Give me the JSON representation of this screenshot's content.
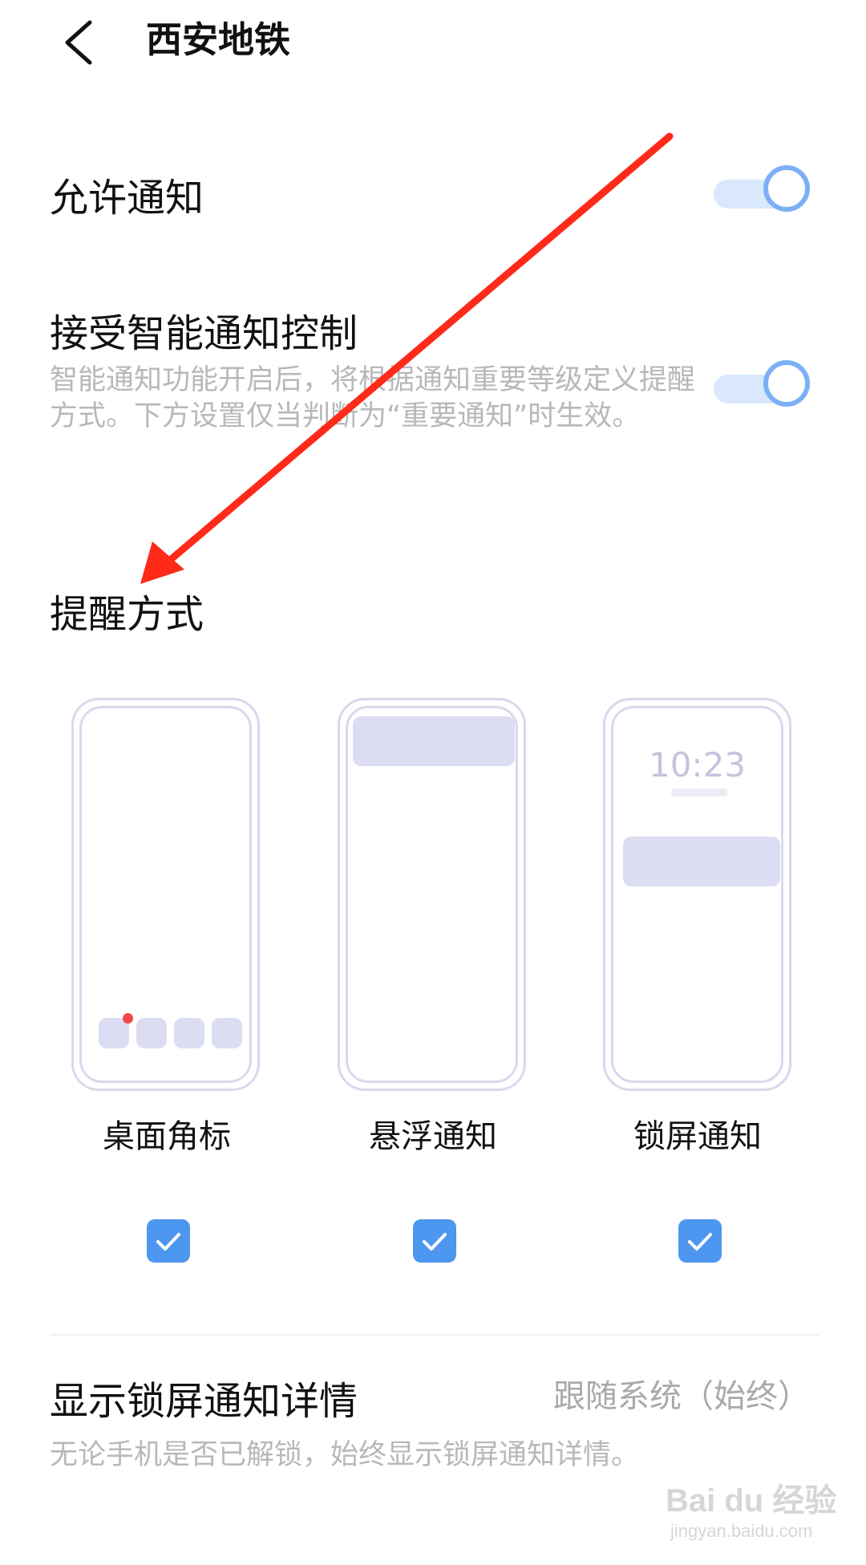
{
  "header": {
    "title": "西安地铁",
    "back_icon": "chevron-left-icon"
  },
  "allow_notifications": {
    "label": "允许通知",
    "enabled": true
  },
  "smart_control": {
    "label": "接受智能通知控制",
    "description": "智能通知功能开启后，将根据通知重要等级定义提醒方式。下方设置仅当判断为“重要通知”时生效。",
    "enabled": true
  },
  "reminder_section": {
    "title": "提醒方式",
    "options": [
      {
        "label": "桌面角标",
        "checked": true
      },
      {
        "label": "悬浮通知",
        "checked": true
      },
      {
        "label": "锁屏通知",
        "checked": true,
        "preview_time": "10:23"
      }
    ]
  },
  "lock_screen_details": {
    "label": "显示锁屏通知详情",
    "value": "跟随系统（始终）",
    "description": "无论手机是否已解锁，始终显示锁屏通知详情。"
  },
  "watermark": {
    "text": "Bai du 经验",
    "url": "jingyan.baidu.com"
  },
  "colors": {
    "accent": "#4e97f0",
    "toggle_track": "#d9e8fd",
    "annotation_arrow": "#ff2a1a",
    "badge": "#f0474a"
  }
}
